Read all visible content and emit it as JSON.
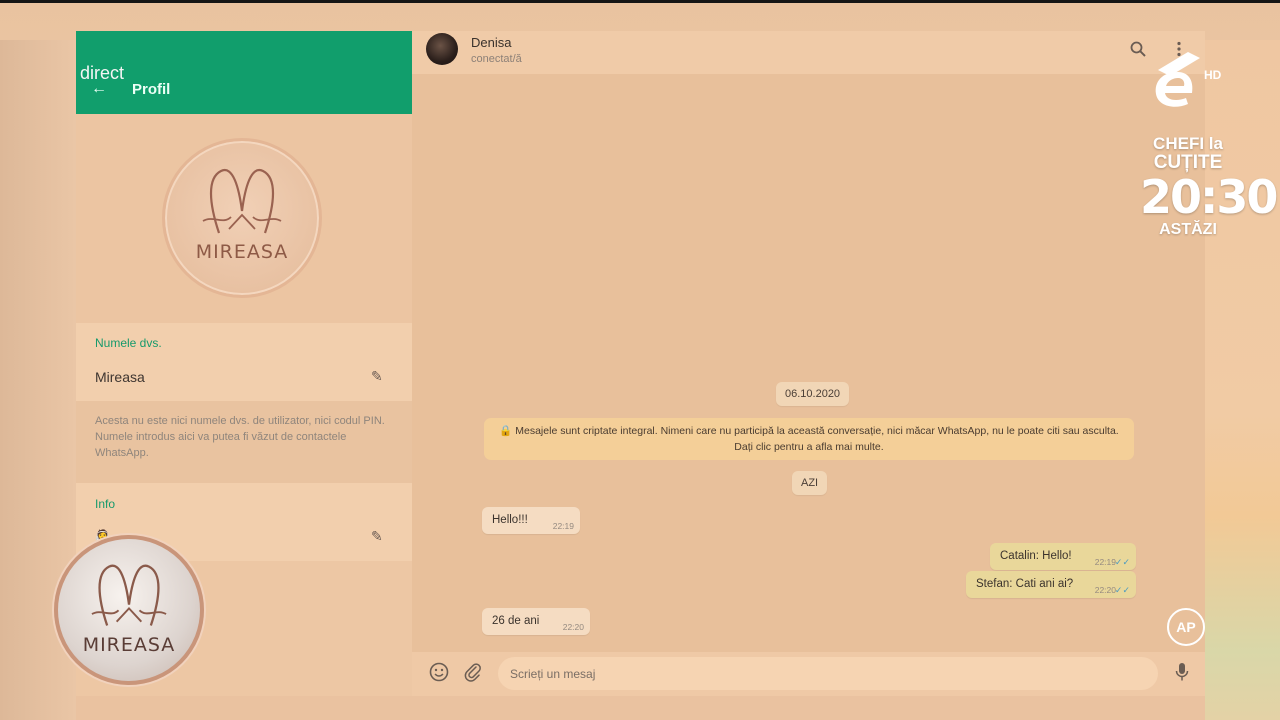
{
  "left_panel": {
    "direct_label": "direct",
    "header_title": "Profil",
    "logo_text": "MIREASA",
    "name_label": "Numele dvs.",
    "name_value": "Mireasa",
    "hint_text": "Acesta nu este nici numele dvs. de utilizator, nici codul PIN. Numele introdus aici va putea fi văzut de contactele WhatsApp.",
    "info_label": "Info",
    "info_value": "👰"
  },
  "chat": {
    "contact_name": "Denisa",
    "contact_status": "conectat/ă",
    "date_chip_1": "06.10.2020",
    "encrypt_notice": "🔒 Mesajele sunt criptate integral. Nimeni care nu participă la această conversație, nici măcar WhatsApp, nu le poate citi sau asculta. Dați clic pentru a afla mai multe.",
    "date_chip_2": "AZI",
    "messages": [
      {
        "direction": "in",
        "text": "Hello!!!",
        "time": "22:19"
      },
      {
        "direction": "out",
        "text": "Catalin: Hello!",
        "time": "22:19",
        "ticks": "✓✓"
      },
      {
        "direction": "out",
        "text": "Stefan: Cati ani ai?",
        "time": "22:20",
        "ticks": "✓✓"
      },
      {
        "direction": "in",
        "text": "26 de ani",
        "time": "22:20"
      }
    ],
    "input_placeholder": "Scrieți un mesaj"
  },
  "overlay": {
    "badge_text": "MIREASA",
    "channel_hd": "HD",
    "promo_line1": "CHEFI la",
    "promo_line2": "CUȚITE",
    "promo_time": "20:30",
    "promo_day": "ASTĂZI",
    "ap_badge": "AP"
  },
  "icons": {
    "back": "arrow-left-icon",
    "edit": "pencil-icon",
    "search": "search-icon",
    "menu": "more-vertical-icon",
    "emoji": "smiley-icon",
    "attach": "paperclip-icon",
    "mic": "microphone-icon"
  },
  "colors": {
    "header_green": "#119e6c",
    "label_green": "#169a6b",
    "incoming_bubble": "#f5dcc2",
    "outgoing_bubble": "#e9d79a",
    "notice": "#f4cf98"
  }
}
